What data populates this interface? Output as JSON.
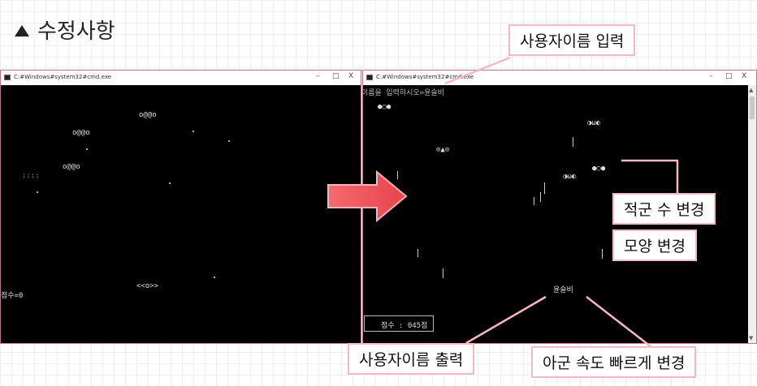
{
  "heading": "수정사항",
  "left_window": {
    "title": "C:#Windows#system32#cmd.exe",
    "controls": [
      "–",
      "□",
      "X"
    ],
    "enemies": [
      "o@@o",
      "o@@o",
      "o@@o"
    ],
    "side_text": "::::",
    "score_text": "점수=0",
    "player": "<<o>>"
  },
  "right_window": {
    "title": "C:#Windows#system32#cmd.exe",
    "controls": [
      "–",
      "□",
      "X"
    ],
    "prompt": "이름을 입력하시오=윤슬비",
    "shapes": [
      "●○●",
      "◑ω◐",
      "⊙▲⊙",
      "●○●",
      "◑ω◐"
    ],
    "player_name": "윤슬비",
    "score_box": "점수 : 045점"
  },
  "callouts": {
    "input": "사용자이름 입력",
    "enemy_count": "적군 수 변경",
    "shape": "모양 변경",
    "output": "사용자이름 출력",
    "speed": "아군 속도 빠르게 변경"
  },
  "colors": {
    "arrow_red": "#e8434b",
    "callout_border": "#f3b9c4",
    "leader_line": "#f5b8c3",
    "console_bg": "#000000"
  }
}
